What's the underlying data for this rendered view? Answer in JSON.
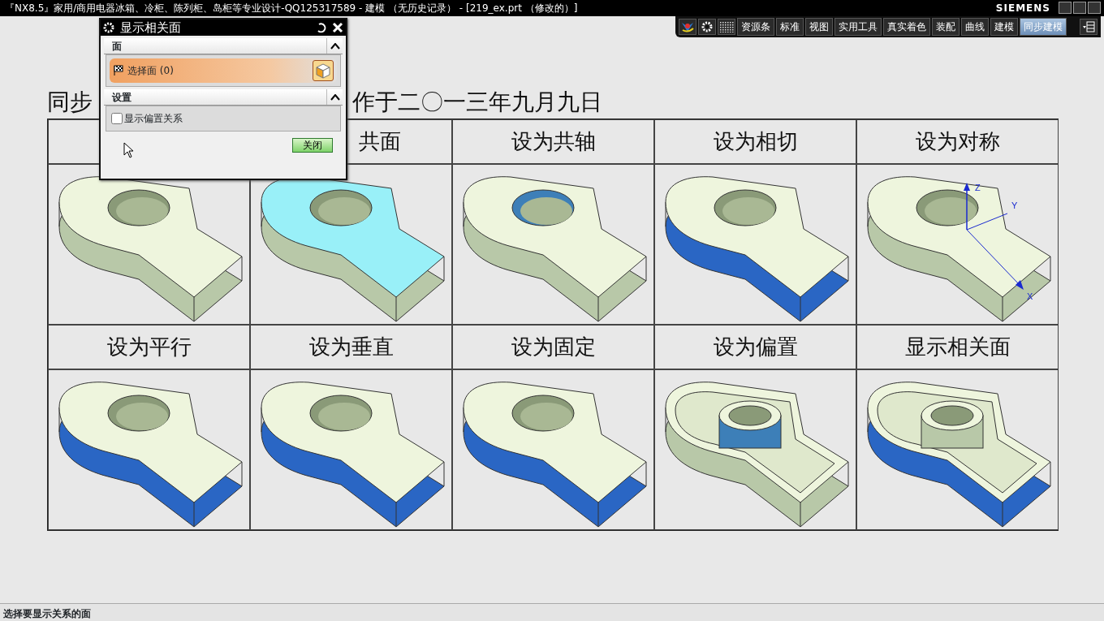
{
  "window": {
    "title": "『NX8.5』家用/商用电器冰箱、冷柜、陈列柜、岛柜等专业设计-QQ125317589 - 建模 （无历史记录） - [219_ex.prt （修改的）]",
    "brand": "SIEMENS"
  },
  "toolbar": {
    "tabs": [
      {
        "label": "资源条",
        "selected": false
      },
      {
        "label": "标准",
        "selected": false
      },
      {
        "label": "视图",
        "selected": false
      },
      {
        "label": "实用工具",
        "selected": false
      },
      {
        "label": "真实着色",
        "selected": false
      },
      {
        "label": "装配",
        "selected": false
      },
      {
        "label": "曲线",
        "selected": false
      },
      {
        "label": "建模",
        "selected": false
      },
      {
        "label": "同步建模",
        "selected": true
      }
    ]
  },
  "heading": [
    "同步",
    "作于二〇一三年九月九日"
  ],
  "grid": {
    "cells": [
      {
        "kind": "plate",
        "top_highlighted": false,
        "hole_highlighted": false,
        "side_highlighted": false
      },
      {
        "label": "共面",
        "kind": "plate",
        "top_highlighted": true,
        "hole_highlighted": false,
        "side_highlighted": false
      },
      {
        "label": "设为共轴",
        "kind": "plate",
        "top_highlighted": false,
        "hole_highlighted": true,
        "side_highlighted": false
      },
      {
        "label": "设为相切",
        "kind": "plate",
        "top_highlighted": false,
        "hole_highlighted": false,
        "side_highlighted": true
      },
      {
        "label": "设为对称",
        "kind": "plate",
        "top_highlighted": false,
        "hole_highlighted": false,
        "side_highlighted": false,
        "axis_labels": [
          "Z",
          "Y",
          "X"
        ]
      },
      {
        "label": "设为平行",
        "kind": "plate",
        "top_highlighted": false,
        "hole_highlighted": false,
        "side_highlighted": true
      },
      {
        "label": "设为垂直",
        "kind": "plate",
        "top_highlighted": false,
        "hole_highlighted": false,
        "side_highlighted": true
      },
      {
        "label": "设为固定",
        "kind": "plate",
        "top_highlighted": false,
        "hole_highlighted": false,
        "side_highlighted": true
      },
      {
        "label": "设为偏置",
        "kind": "shell",
        "top_highlighted": false,
        "hole_highlighted": true,
        "side_highlighted": false
      },
      {
        "label": "显示相关面",
        "kind": "shell",
        "top_highlighted": false,
        "hole_highlighted": false,
        "side_highlighted": true
      }
    ]
  },
  "dialog": {
    "title": "显示相关面",
    "sections": [
      {
        "title": "面",
        "expanded": true
      },
      {
        "title": "设置",
        "expanded": true
      }
    ],
    "select": {
      "label": "选择面 (0)"
    },
    "checkbox": {
      "label": "显示偏置关系",
      "checked": false
    },
    "close_button": "关闭"
  },
  "status_bar": "选择要显示关系的面"
}
